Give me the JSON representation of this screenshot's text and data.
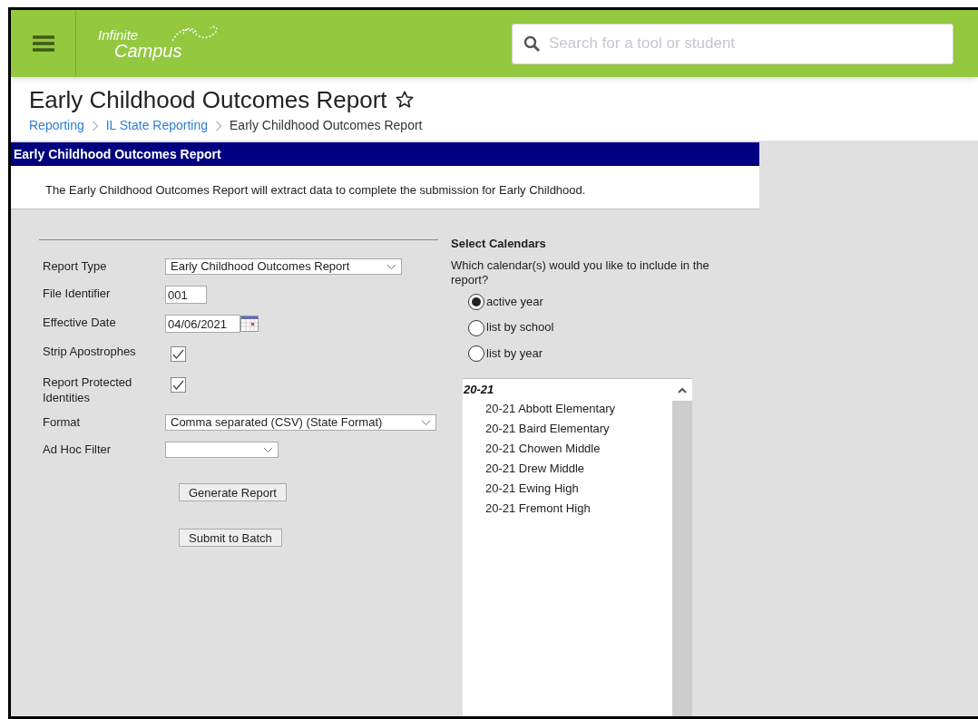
{
  "header": {
    "logo": {
      "line1": "Infinite",
      "line2": "Campus"
    },
    "search": {
      "placeholder": "Search for a tool or student"
    }
  },
  "page": {
    "title": "Early Childhood Outcomes Report",
    "breadcrumbs": [
      {
        "label": "Reporting",
        "kind": "link"
      },
      {
        "label": "IL State Reporting",
        "kind": "link"
      },
      {
        "label": "Early Childhood Outcomes Report",
        "kind": "current"
      }
    ]
  },
  "panel": {
    "title": "Early Childhood Outcomes Report",
    "description": "The Early Childhood Outcomes Report will extract data to complete the submission for Early Childhood."
  },
  "form": {
    "fields": [
      {
        "kind": "select",
        "label": "Report Type",
        "value": "Early Childhood Outcomes Report"
      },
      {
        "kind": "text",
        "label": "File Identifier",
        "value": "001"
      },
      {
        "kind": "date",
        "label": "Effective Date",
        "value": "04/06/2021"
      },
      {
        "kind": "checkbox",
        "label": "Strip Apostrophes",
        "checked": true
      },
      {
        "kind": "checkbox",
        "label": "Report Protected Identities",
        "checked": true
      },
      {
        "kind": "wideselect",
        "label": "Format",
        "value": "Comma separated (CSV) (State Format)"
      },
      {
        "kind": "smallselect",
        "label": "Ad Hoc Filter"
      }
    ],
    "buttons": [
      "Generate Report",
      "Submit to Batch"
    ]
  },
  "calendars": {
    "heading": "Select Calendars",
    "question": "Which calendar(s) would you like to include in the report?",
    "options": [
      {
        "label": "active year",
        "selected": true
      },
      {
        "label": "list by school",
        "selected": false
      },
      {
        "label": "list by year",
        "selected": false
      }
    ],
    "group": "20-21",
    "items": [
      "20-21 Abbott Elementary",
      "20-21 Baird Elementary",
      "20-21 Chowen Middle",
      "20-21 Drew Middle",
      "20-21 Ewing High",
      "20-21 Fremont High"
    ]
  }
}
